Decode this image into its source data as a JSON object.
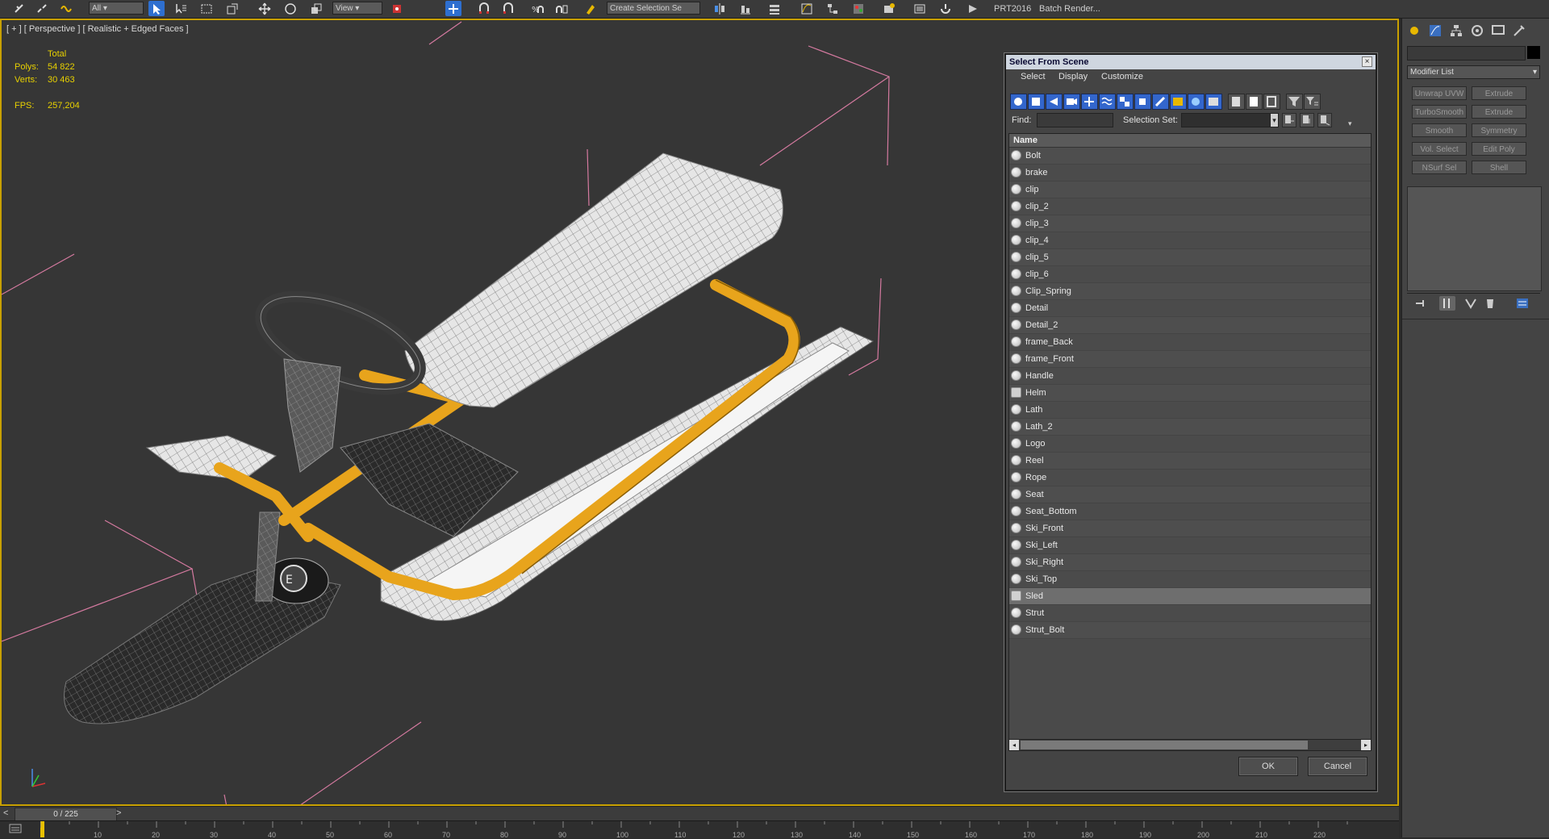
{
  "toolbar": {
    "view_combo": "View",
    "selection_set_combo": "Create Selection Se",
    "renderer_label": "PRT2016",
    "batch_render_label": "Batch Render..."
  },
  "viewport": {
    "label": "[ + ] [ Perspective ] [ Realistic + Edged Faces ]",
    "stats_total_label": "Total",
    "polys_label": "Polys:",
    "polys_value": "54 822",
    "verts_label": "Verts:",
    "verts_value": "30 463",
    "fps_label": "FPS:",
    "fps_value": "257,204"
  },
  "command_panel": {
    "modifier_list_label": "Modifier List",
    "modifiers": [
      "Unwrap UVW",
      "Extrude",
      "TurboSmooth",
      "Extrude",
      "Smooth",
      "Symmetry",
      "Vol. Select",
      "Edit Poly",
      "NSurf Sel",
      "Shell"
    ]
  },
  "dialog": {
    "title": "Select From Scene",
    "close_label": "×",
    "menu": [
      "Select",
      "Display",
      "Customize"
    ],
    "find_label": "Find:",
    "find_value": "",
    "selection_set_label": "Selection Set:",
    "selection_set_value": "",
    "column_name": "Name",
    "objects": [
      {
        "name": "Bolt",
        "kind": "object"
      },
      {
        "name": "brake",
        "kind": "object"
      },
      {
        "name": "clip",
        "kind": "object"
      },
      {
        "name": "clip_2",
        "kind": "object"
      },
      {
        "name": "clip_3",
        "kind": "object"
      },
      {
        "name": "clip_4",
        "kind": "object"
      },
      {
        "name": "clip_5",
        "kind": "object"
      },
      {
        "name": "clip_6",
        "kind": "object"
      },
      {
        "name": "Clip_Spring",
        "kind": "object"
      },
      {
        "name": "Detail",
        "kind": "object"
      },
      {
        "name": "Detail_2",
        "kind": "object"
      },
      {
        "name": "frame_Back",
        "kind": "object"
      },
      {
        "name": "frame_Front",
        "kind": "object"
      },
      {
        "name": "Handle",
        "kind": "object"
      },
      {
        "name": "Helm",
        "kind": "group"
      },
      {
        "name": "Lath",
        "kind": "object"
      },
      {
        "name": "Lath_2",
        "kind": "object"
      },
      {
        "name": "Logo",
        "kind": "object"
      },
      {
        "name": "Reel",
        "kind": "object"
      },
      {
        "name": "Rope",
        "kind": "object"
      },
      {
        "name": "Seat",
        "kind": "object"
      },
      {
        "name": "Seat_Bottom",
        "kind": "object"
      },
      {
        "name": "Ski_Front",
        "kind": "object"
      },
      {
        "name": "Ski_Left",
        "kind": "object"
      },
      {
        "name": "Ski_Right",
        "kind": "object"
      },
      {
        "name": "Ski_Top",
        "kind": "object"
      },
      {
        "name": "Sled",
        "kind": "group",
        "selected": true
      },
      {
        "name": "Strut",
        "kind": "object"
      },
      {
        "name": "Strut_Bolt",
        "kind": "object"
      }
    ],
    "ok_label": "OK",
    "cancel_label": "Cancel"
  },
  "timeline": {
    "frame_counter": "0 / 225",
    "prev_label": "<",
    "next_label": ">",
    "ticks": [
      "10",
      "20",
      "30",
      "40",
      "50",
      "60",
      "70",
      "80",
      "90",
      "100",
      "110",
      "120",
      "130",
      "140",
      "150",
      "160",
      "170",
      "180",
      "190",
      "200",
      "210",
      "220"
    ]
  },
  "colors": {
    "viewport_border": "#c8a000",
    "stats_text": "#e8d100",
    "frame_orange": "#e8a41c",
    "active_button": "#2e6fd0"
  }
}
